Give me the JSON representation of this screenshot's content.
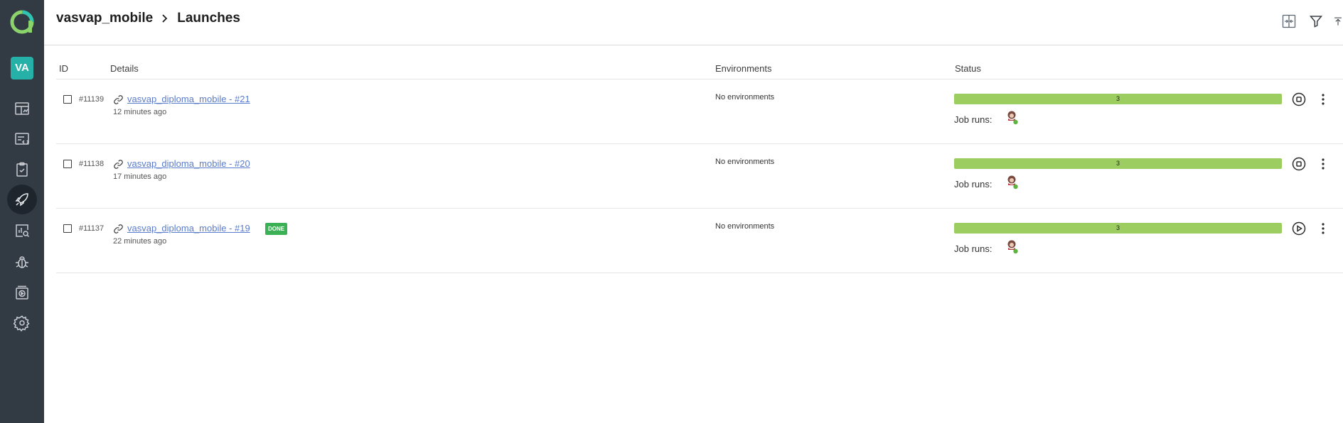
{
  "header": {
    "project": "vasvap_mobile",
    "page": "Launches"
  },
  "sidebar": {
    "avatar_initials": "VA",
    "items": [
      {
        "icon": "dashboard-icon"
      },
      {
        "icon": "test-cases-icon"
      },
      {
        "icon": "test-plans-icon"
      },
      {
        "icon": "launches-icon",
        "active": true
      },
      {
        "icon": "analytics-icon"
      },
      {
        "icon": "defects-icon"
      },
      {
        "icon": "jobs-icon"
      },
      {
        "icon": "settings-icon"
      }
    ]
  },
  "table": {
    "columns": {
      "id": "ID",
      "details": "Details",
      "environments": "Environments",
      "status": "Status"
    },
    "rows": [
      {
        "id": "#11139",
        "name": "vasvap_diploma_mobile - #21",
        "time": "12 minutes ago",
        "env": "No environments",
        "count": "3",
        "job_label": "Job runs:",
        "badge": "",
        "action": "stop"
      },
      {
        "id": "#11138",
        "name": "vasvap_diploma_mobile - #20",
        "time": "17 minutes ago",
        "env": "No environments",
        "count": "3",
        "job_label": "Job runs:",
        "badge": "",
        "action": "stop"
      },
      {
        "id": "#11137",
        "name": "vasvap_diploma_mobile - #19",
        "time": "22 minutes ago",
        "env": "No environments",
        "count": "3",
        "job_label": "Job runs:",
        "badge": "DONE",
        "action": "play"
      }
    ]
  },
  "colors": {
    "sidebar": "#323a44",
    "accent": "#25b1a7",
    "progress": "#9ccd61",
    "link": "#5a7ccc",
    "done_badge": "#3cb054"
  }
}
